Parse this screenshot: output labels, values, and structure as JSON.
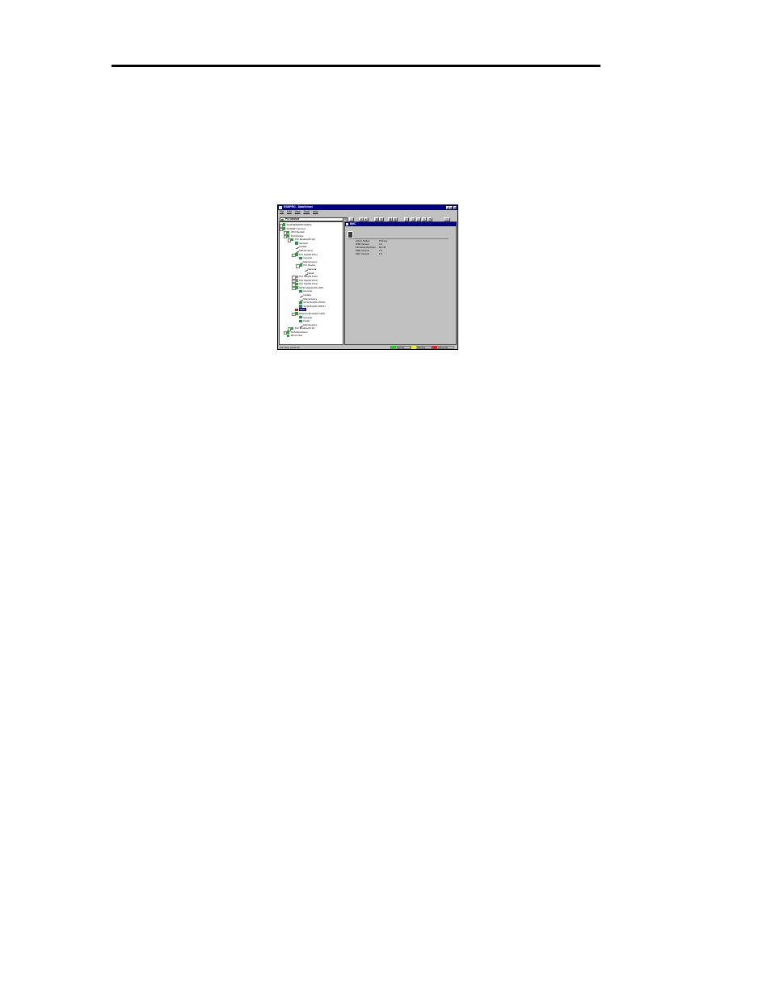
{
  "window": {
    "title": "ESMPRO - DataViewer",
    "menu": [
      "File",
      "Edit",
      "View",
      "Tools",
      "Help"
    ],
    "combo_value": "PCI Module"
  },
  "tree": [
    {
      "label": "SCI#1[ESMPRO1RES]",
      "level": 0,
      "icon": "green",
      "exp": "+"
    },
    {
      "label": "SCI#2[FT Server]",
      "level": 0,
      "icon": "green",
      "exp": "-"
    },
    {
      "label": "CPU Module",
      "level": 1,
      "icon": "green",
      "exp": "+"
    },
    {
      "label": "PCI Module",
      "level": 1,
      "icon": "green",
      "exp": "-"
    },
    {
      "label": "PCI Module(ID:10)",
      "level": 2,
      "icon": "green",
      "exp": "-"
    },
    {
      "label": "General",
      "level": 3,
      "icon": "leaf"
    },
    {
      "label": "Update",
      "level": 3,
      "icon": "wrench"
    },
    {
      "label": "Maintenance",
      "level": 3,
      "icon": "wrench"
    },
    {
      "label": "PCI Slot(ID:10/1)",
      "level": 3,
      "icon": "green",
      "exp": "-"
    },
    {
      "label": "General",
      "level": 4,
      "icon": "leaf"
    },
    {
      "label": "Maintenance",
      "level": 4,
      "icon": "wrench"
    },
    {
      "label": "PCI Device",
      "level": 4,
      "icon": "green",
      "exp": "-"
    },
    {
      "label": "General",
      "level": 5,
      "icon": "wrench"
    },
    {
      "label": "Detail",
      "level": 5,
      "icon": "wrench"
    },
    {
      "label": "PCI Slot(ID:10/2)",
      "level": 3,
      "icon": "grey",
      "exp": "+"
    },
    {
      "label": "PCI Slot(ID:10/3)",
      "level": 3,
      "icon": "grey",
      "exp": "+"
    },
    {
      "label": "PCI Slot(ID:10/4)",
      "level": 3,
      "icon": "green",
      "exp": "+"
    },
    {
      "label": "SCSI Adapter(ID:10/5)",
      "level": 3,
      "icon": "green",
      "exp": "-"
    },
    {
      "label": "General",
      "level": 4,
      "icon": "leaf"
    },
    {
      "label": "Update",
      "level": 4,
      "icon": "wrench"
    },
    {
      "label": "Maintenance",
      "level": 4,
      "icon": "wrench"
    },
    {
      "label": "SCSI Bus(ID:10/5/0)",
      "level": 4,
      "icon": "leaf"
    },
    {
      "label": "SCSI Bus(ID:10/5/1)",
      "level": 4,
      "icon": "leaf"
    },
    {
      "label": "BMC",
      "level": 3,
      "icon": "red",
      "selected": true
    },
    {
      "label": "Ethernet Board(ID:10/6)",
      "level": 3,
      "icon": "green",
      "exp": "-"
    },
    {
      "label": "General",
      "level": 4,
      "icon": "leaf"
    },
    {
      "label": "Detail",
      "level": 4,
      "icon": "leaf"
    },
    {
      "label": "Maintenance",
      "level": 4,
      "icon": "wrench"
    },
    {
      "label": "PCI Module(ID:11)",
      "level": 2,
      "icon": "green",
      "exp": "+"
    },
    {
      "label": "SCSI Enclosure",
      "level": 1,
      "icon": "green",
      "exp": "+"
    },
    {
      "label": "Mirror Disk",
      "level": 1,
      "icon": "green"
    }
  ],
  "pane": {
    "title": "BMC",
    "properties": [
      {
        "key": "Active Status",
        "value": "Primary"
      },
      {
        "key": "IPMI Version",
        "value": "1.0"
      },
      {
        "key": "Firmware Revision",
        "value": "00.1B"
      },
      {
        "key": "SDR Version",
        "value": "7.0"
      },
      {
        "key": "SDC Version",
        "value": "1.0"
      }
    ]
  },
  "status": {
    "text": "For Help, press F1",
    "legend": [
      {
        "label": "Normal",
        "color": "#22cc22"
      },
      {
        "label": "Warning",
        "color": "#eeee22"
      },
      {
        "label": "Abnormal",
        "color": "#dd2222"
      }
    ]
  }
}
